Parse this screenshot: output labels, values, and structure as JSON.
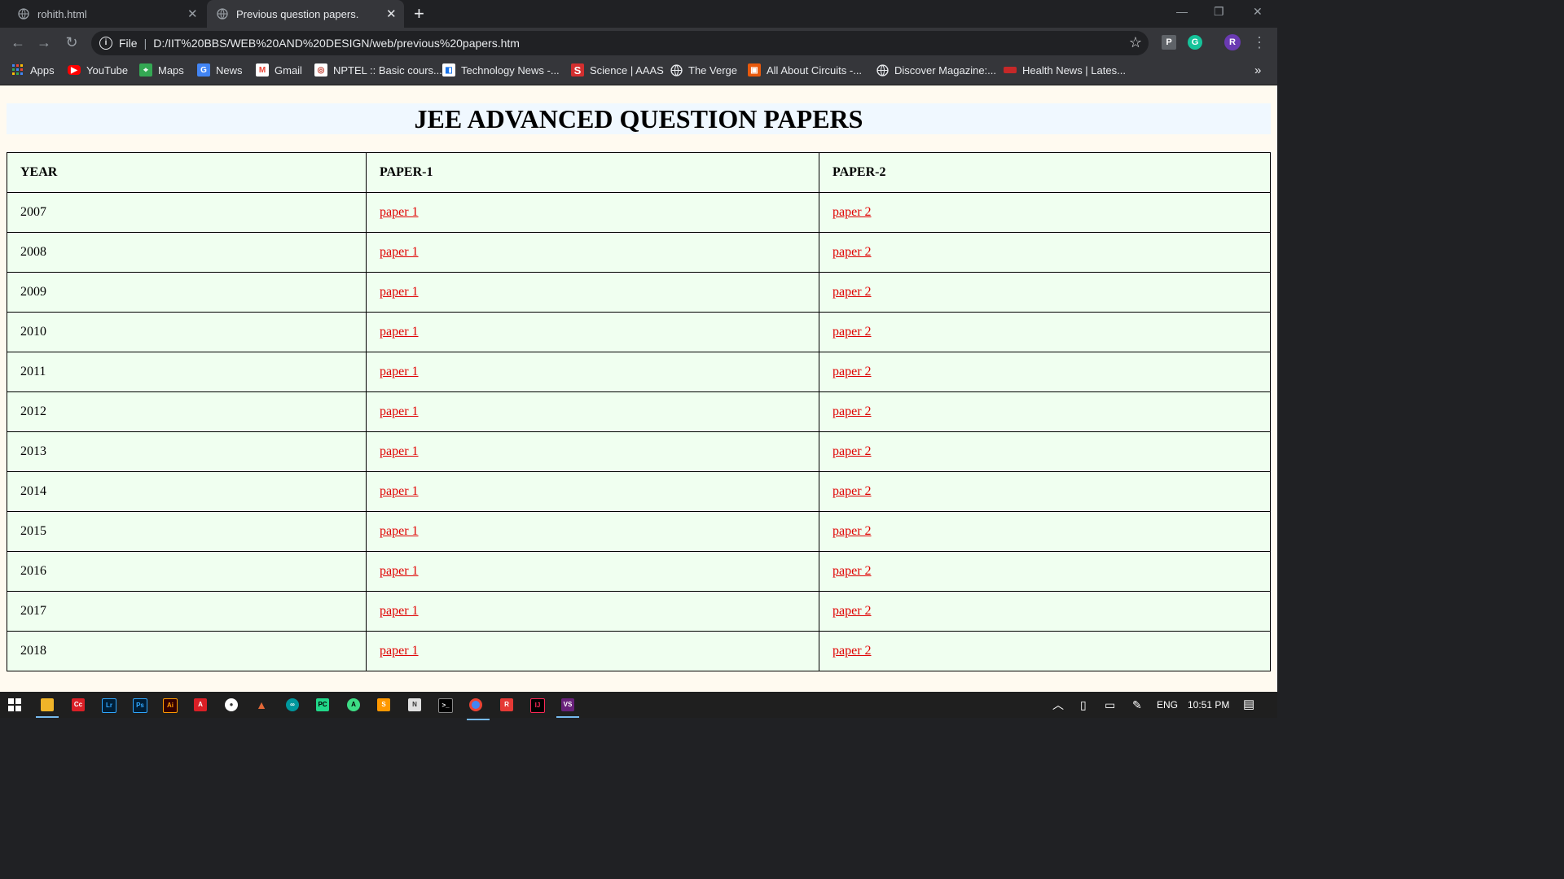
{
  "browser": {
    "tabs": [
      {
        "title": "rohith.html"
      },
      {
        "title": "Previous question papers."
      }
    ],
    "url": {
      "scheme": "File",
      "path": "D:/IIT%20BBS/WEB%20AND%20DESIGN/web/previous%20papers.htm"
    },
    "profile_initial": "R",
    "bookmarks": [
      {
        "label": "Apps",
        "icon": "apps-grid-icon"
      },
      {
        "label": "YouTube",
        "icon": "youtube-icon"
      },
      {
        "label": "Maps",
        "icon": "maps-icon"
      },
      {
        "label": "News",
        "icon": "google-news-icon"
      },
      {
        "label": "Gmail",
        "icon": "gmail-icon"
      },
      {
        "label": "NPTEL :: Basic cours...",
        "icon": "nptel-icon"
      },
      {
        "label": "Technology News -...",
        "icon": "technology-news-icon"
      },
      {
        "label": "Science | AAAS",
        "icon": "science-aaas-icon"
      },
      {
        "label": "The Verge",
        "icon": "globe-icon"
      },
      {
        "label": "All About Circuits -...",
        "icon": "all-about-circuits-icon"
      },
      {
        "label": "Discover Magazine:...",
        "icon": "globe-icon"
      },
      {
        "label": "Health News | Lates...",
        "icon": "health-news-icon"
      }
    ],
    "bookmarks_overflow": "»"
  },
  "page": {
    "heading": "JEE ADVANCED QUESTION PAPERS",
    "table": {
      "headers": [
        "YEAR",
        "PAPER-1",
        "PAPER-2"
      ],
      "rows": [
        {
          "year": "2007",
          "paper1": "paper 1",
          "paper2": "paper 2"
        },
        {
          "year": "2008",
          "paper1": "paper 1",
          "paper2": "paper 2"
        },
        {
          "year": "2009",
          "paper1": "paper 1",
          "paper2": "paper 2"
        },
        {
          "year": "2010",
          "paper1": "paper 1",
          "paper2": "paper 2"
        },
        {
          "year": "2011",
          "paper1": "paper 1",
          "paper2": "paper 2"
        },
        {
          "year": "2012",
          "paper1": "paper 1",
          "paper2": "paper 2"
        },
        {
          "year": "2013",
          "paper1": "paper 1",
          "paper2": "paper 2"
        },
        {
          "year": "2014",
          "paper1": "paper 1",
          "paper2": "paper 2"
        },
        {
          "year": "2015",
          "paper1": "paper 1",
          "paper2": "paper 2"
        },
        {
          "year": "2016",
          "paper1": "paper 1",
          "paper2": "paper 2"
        },
        {
          "year": "2017",
          "paper1": "paper 1",
          "paper2": "paper 2"
        },
        {
          "year": "2018",
          "paper1": "paper 1",
          "paper2": "paper 2"
        }
      ]
    },
    "colors": {
      "page_bg": "#fffaf0",
      "heading_bg": "#f0f8ff",
      "table_bg": "#f0fff0",
      "link": "#e00000"
    }
  },
  "taskbar": {
    "apps": [
      "windows-start-icon",
      "file-explorer-icon",
      "adobe-cc-icon",
      "lightroom-icon",
      "photoshop-icon",
      "illustrator-icon",
      "acrobat-icon",
      "obs-icon",
      "matlab-icon",
      "arduino-icon",
      "pycharm-icon",
      "android-studio-icon",
      "sublime-text-icon",
      "notepad-icon",
      "terminal-icon",
      "chrome-icon",
      "recorder-icon",
      "intellij-icon",
      "visual-studio-icon"
    ],
    "language": "ENG",
    "time": "10:51 PM"
  }
}
